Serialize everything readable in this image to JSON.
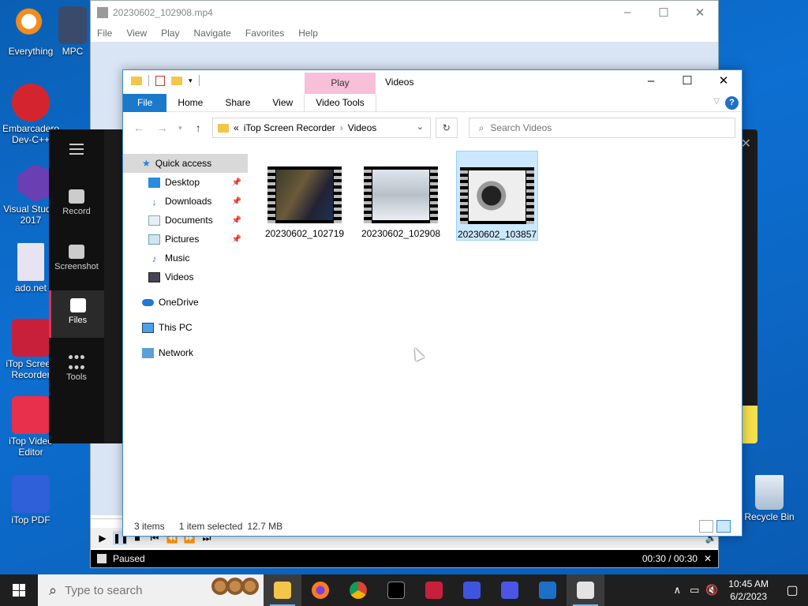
{
  "desktop": {
    "icons": [
      {
        "label": "Everything"
      },
      {
        "label": "MPC"
      },
      {
        "label": "Embarcadero Dev-C++"
      },
      {
        "label": "Visual Studio 2017"
      },
      {
        "label": "ado.net"
      },
      {
        "label": "iTop Screen Recorder"
      },
      {
        "label": "iTop Video Editor"
      },
      {
        "label": "iTop PDF"
      }
    ],
    "recycle_bin": "Recycle Bin"
  },
  "mpc": {
    "title": "20230602_102908.mp4",
    "menu": [
      "File",
      "View",
      "Play",
      "Navigate",
      "Favorites",
      "Help"
    ],
    "status": "Paused",
    "time": "00:30 / 00:30"
  },
  "itop": {
    "nav": [
      {
        "label": "Record"
      },
      {
        "label": "Screenshot"
      },
      {
        "label": "Files"
      },
      {
        "label": "Tools"
      }
    ]
  },
  "explorer": {
    "contextual_tab": "Play",
    "title": "Videos",
    "ribbon_tabs": [
      "File",
      "Home",
      "Share",
      "View",
      "Video Tools"
    ],
    "breadcrumb": {
      "prefix": "«",
      "parts": [
        "iTop Screen Recorder",
        "Videos"
      ]
    },
    "search_placeholder": "Search Videos",
    "nav": {
      "quick_access": "Quick access",
      "pinned": [
        {
          "label": "Desktop"
        },
        {
          "label": "Downloads"
        },
        {
          "label": "Documents"
        },
        {
          "label": "Pictures"
        }
      ],
      "unpinned": [
        {
          "label": "Music"
        },
        {
          "label": "Videos"
        }
      ],
      "onedrive": "OneDrive",
      "this_pc": "This PC",
      "network": "Network"
    },
    "files": [
      {
        "name": "20230602_102719"
      },
      {
        "name": "20230602_102908"
      },
      {
        "name": "20230602_103857"
      }
    ],
    "status": {
      "items": "3 items",
      "selected": "1 item selected",
      "size": "12.7 MB"
    }
  },
  "taskbar": {
    "search_placeholder": "Type to search",
    "time": "10:45 AM",
    "date": "6/2/2023"
  }
}
